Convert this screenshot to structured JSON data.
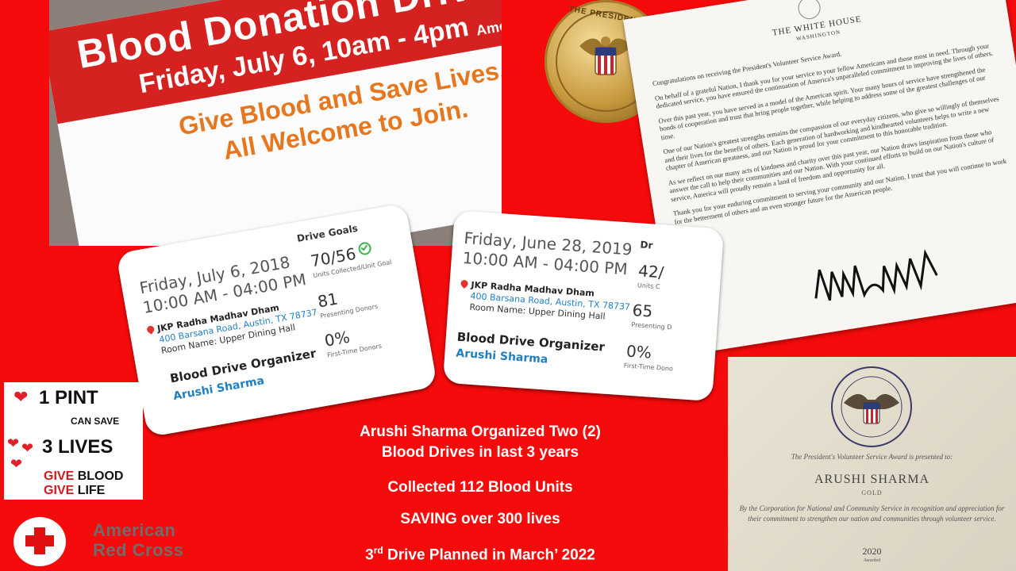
{
  "banner": {
    "title": "Blood Donation Drive",
    "date_line": "Friday, July 6, 10am - 4pm",
    "give_line": "Give Blood and Save Lives.",
    "join_line": "All Welcome to Join.",
    "brand": "American"
  },
  "medal": {
    "inscription": "THE PRESIDENT'S",
    "icon": "eagle-shield-icon"
  },
  "letter": {
    "title": "THE WHITE HOUSE",
    "subtitle": "WASHINGTON",
    "paragraphs": [
      "Congratulations on receiving the President's Volunteer Service Award.",
      "On behalf of a grateful Nation, I thank you for your service to your fellow Americans and those most in need. Through your dedicated service, you have ensured the continuation of America's unparalleled commitment to improving the lives of others.",
      "Over this past year, you have served as a model of the American spirit. Your many hours of service have strengthened the bonds of cooperation and trust that bring people together, while helping to address some of the greatest challenges of our time.",
      "One of our Nation's greatest strengths remains the compassion of our everyday citizens, who give so willingly of themselves and their lives for the benefit of others. Each generation of hardworking and kindhearted volunteers helps to write a new chapter of American greatness, and our Nation is proud for your commitment to this honorable tradition.",
      "As we reflect on our many acts of kindness and charity over this past year, our Nation draws inspiration from those who answer the call to help their communities and our Nation. With your continued efforts to build on our Nation's culture of service, America will proudly remain a land of freedom and opportunity for all.",
      "Thank you for your enduring commitment to serving your community and our Nation. I trust that you will continue to work for the betterment of others and an even stronger future for the American people."
    ]
  },
  "card1": {
    "goals_label": "Drive Goals",
    "date": "Friday, July 6, 2018",
    "time": "10:00 AM - 04:00 PM",
    "venue": "JKP Radha Madhav Dham",
    "address": "400 Barsana Road, Austin, TX 78737",
    "room": "Room Name: Upper Dining Hall",
    "organizer_label": "Blood Drive Organizer",
    "organizer_name": "Arushi Sharma",
    "units_value": "70/56",
    "units_label": "Units Collected/Unit Goal",
    "donors_value": "81",
    "donors_label": "Presenting Donors",
    "first_value": "0%",
    "first_label": "First-Time Donors"
  },
  "card2": {
    "goals_label": "Dr",
    "date": "Friday, June 28, 2019",
    "time": "10:00 AM - 04:00 PM",
    "venue": "JKP Radha Madhav Dham",
    "address": "400 Barsana Road, Austin, TX 78737",
    "room": "Room Name: Upper Dining Hall",
    "organizer_label": "Blood Drive Organizer",
    "organizer_name": "Arushi Sharma",
    "units_value": "42/",
    "units_label": "Units C",
    "donors_value": "65",
    "donors_label": "Presenting D",
    "first_value": "0%",
    "first_label": "First-Time Dono"
  },
  "pint": {
    "line1": "1 PINT",
    "line2": "CAN SAVE",
    "line3": "3 LIVES",
    "give_a": "GIVE ",
    "give_b": "BLOOD",
    "life_a": "GIVE ",
    "life_b": "LIFE"
  },
  "logo": {
    "line1": "American",
    "line2": "Red Cross",
    "icon": "red-cross-icon"
  },
  "caption": {
    "line1": "Arushi Sharma Organized Two (2)",
    "line2": "Blood Drives in last 3 years",
    "line3": "Collected 112 Blood Units",
    "line4": "SAVING over 300 lives",
    "line5_a": "3",
    "line5_sup": "rd",
    "line5_b": " Drive Planned in March’ 2022"
  },
  "certificate": {
    "presented": "The President's Volunteer Service Award is presented to:",
    "name": "ARUSHI SHARMA",
    "level": "GOLD",
    "text": "By the Corporation for National and Community Service in recognition and appreciation for their commitment to strengthen our nation and communities through volunteer service.",
    "year": "2020",
    "awarded": "Awarded"
  },
  "colors": {
    "background": "#f50b0b",
    "link_blue": "#1f7fc2",
    "banner_red": "#d5211f",
    "banner_orange": "#e6771f"
  }
}
